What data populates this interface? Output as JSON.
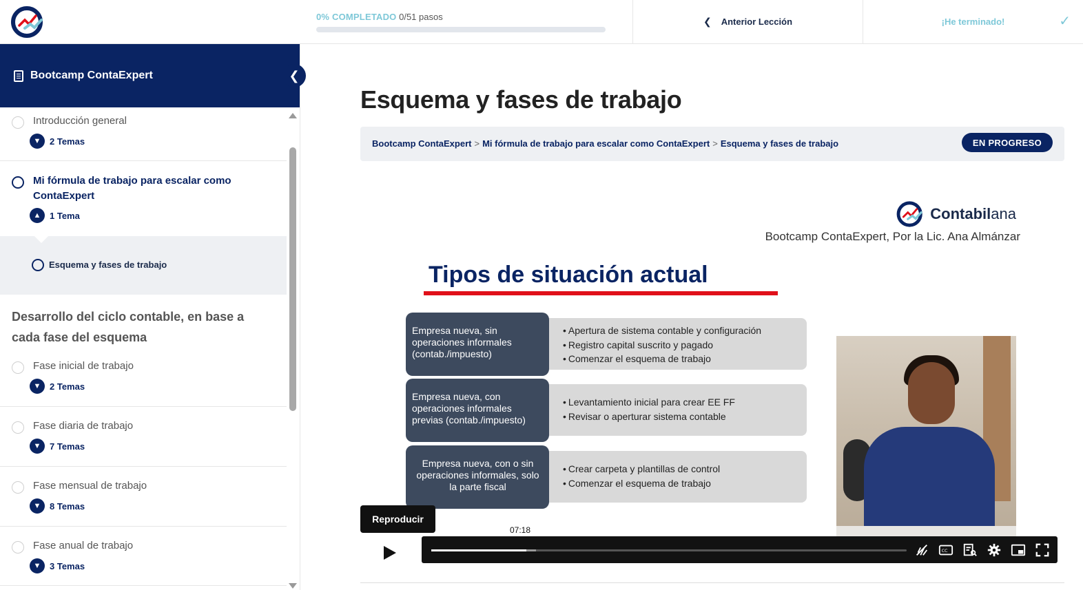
{
  "progress": {
    "percent_label": "0% COMPLETADO",
    "steps_label": "0/51 pasos",
    "fraction": 0
  },
  "nav": {
    "prev_label": "Anterior Lección",
    "finished_label": "¡He terminado!"
  },
  "sidebar": {
    "course_title": "Bootcamp ContaExpert",
    "lessons": [
      {
        "title": "Introducción general",
        "topics": "2 Temas"
      },
      {
        "title": "Mi fórmula de trabajo para escalar como ContaExpert",
        "topics": "1 Tema",
        "sub": "Esquema y fases de trabajo"
      },
      {
        "title": "Fase inicial de trabajo",
        "topics": "2 Temas"
      },
      {
        "title": "Fase diaria de trabajo",
        "topics": "7 Temas"
      },
      {
        "title": "Fase mensual de trabajo",
        "topics": "8 Temas"
      },
      {
        "title": "Fase anual de trabajo",
        "topics": "3 Temas"
      }
    ],
    "section_title": "Desarrollo del ciclo contable, en base a cada fase del esquema"
  },
  "main": {
    "title": "Esquema y fases de trabajo",
    "breadcrumbs": [
      "Bootcamp ContaExpert",
      "Mi fórmula de trabajo para escalar como ContaExpert",
      "Esquema y fases de trabajo"
    ],
    "breadcrumb_sep": ">",
    "status": "EN PROGRESO"
  },
  "video": {
    "brand_bold": "Contabil",
    "brand_light": "ana",
    "byline": "Bootcamp  ContaExpert, Por la Lic. Ana Almánzar",
    "slide_title": "Tipos de situación actual",
    "rows": [
      {
        "box": "Empresa nueva, sin operaciones informales (contab./impuesto)",
        "items": [
          "Apertura de sistema contable y configuración",
          "Registro capital suscrito y pagado",
          "Comenzar el esquema de trabajo"
        ]
      },
      {
        "box": "Empresa nueva, con operaciones informales previas (contab./impuesto)",
        "items": [
          "Levantamiento inicial para crear EE FF",
          "Revisar o aperturar sistema contable"
        ]
      },
      {
        "box": "Empresa nueva, con o sin operaciones informales, solo la parte fiscal",
        "items": [
          "Crear carpeta y plantillas de control",
          "Comenzar el esquema de trabajo"
        ]
      }
    ],
    "play_tooltip": "Reproducir",
    "time": "07:18",
    "played_fraction": 0.2
  },
  "colors": {
    "navy": "#0a2463",
    "accent": "#7ec8d8",
    "red": "#e0101a"
  }
}
